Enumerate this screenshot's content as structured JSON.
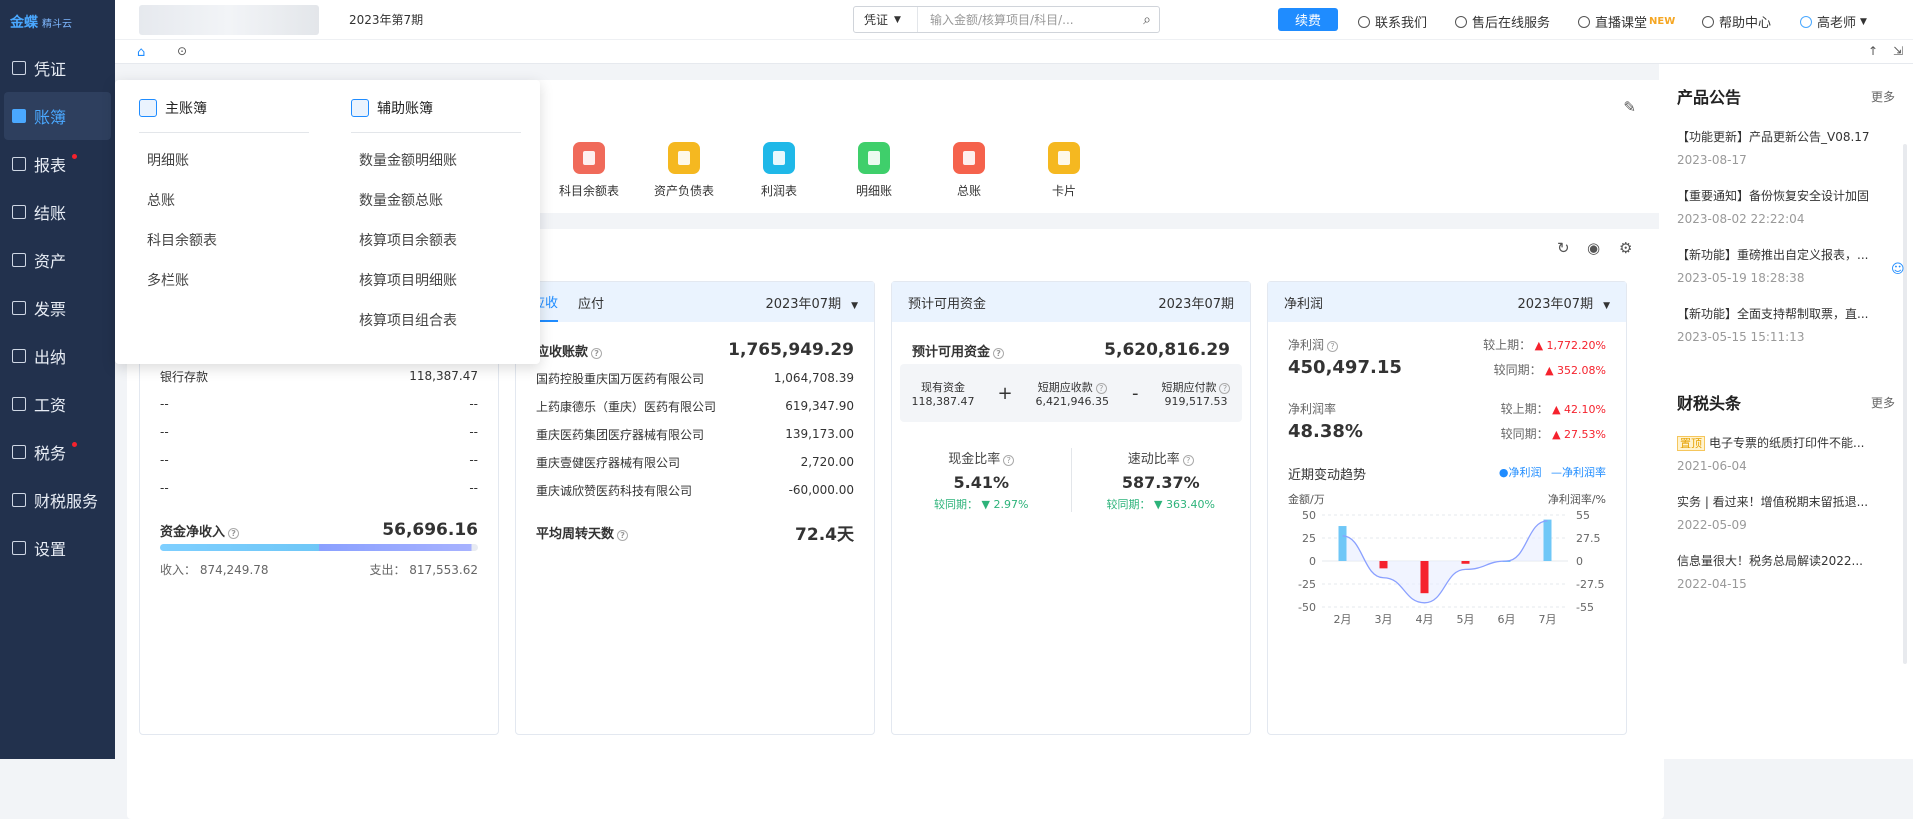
{
  "app": {
    "logo": "金蝶",
    "logo_sub": "精斗云",
    "period": "2023年第7期"
  },
  "sidebar": {
    "items": [
      {
        "label": "凭证"
      },
      {
        "label": "账簿"
      },
      {
        "label": "报表"
      },
      {
        "label": "结账"
      },
      {
        "label": "资产"
      },
      {
        "label": "发票"
      },
      {
        "label": "出纳"
      },
      {
        "label": "工资"
      },
      {
        "label": "税务"
      },
      {
        "label": "财税服务"
      },
      {
        "label": "设置"
      }
    ]
  },
  "search": {
    "select": "凭证",
    "placeholder": "输入金额/核算项目/科目/..."
  },
  "topbar": {
    "renew": "续费",
    "contact": "联系我们",
    "support": "售后在线服务",
    "live": "直播课堂",
    "live_badge": "NEW",
    "help": "帮助中心",
    "user": "高老师"
  },
  "dropdown": {
    "main_title": "主账簿",
    "main_items": [
      "明细账",
      "总账",
      "科目余额表",
      "多栏账"
    ],
    "aux_title": "辅助账簿",
    "aux_items": [
      "数量金额明细账",
      "数量金额总账",
      "核算项目余额表",
      "核算项目明细账",
      "核算项目组合表"
    ]
  },
  "quick": {
    "items": [
      {
        "label": "科目余额表",
        "color": "#f06a5a"
      },
      {
        "label": "资产负债表",
        "color": "#f5b820"
      },
      {
        "label": "利润表",
        "color": "#1fb8e8"
      },
      {
        "label": "明细账",
        "color": "#3fcf6b"
      },
      {
        "label": "总账",
        "color": "#f5624c"
      },
      {
        "label": "卡片",
        "color": "#f5b820"
      }
    ]
  },
  "cash": {
    "bank_label": "银行存款",
    "bank_value": "118,387.47",
    "dash_rows": [
      [
        "--",
        "--"
      ],
      [
        "--",
        "--"
      ],
      [
        "--",
        "--"
      ],
      [
        "--",
        "--"
      ]
    ],
    "net_label": "资金净收入",
    "net_value": "56,696.16",
    "income": "收入： 874,249.78",
    "expense": "支出： 817,553.62"
  },
  "receivable": {
    "tab1": "应收",
    "tab2": "应付",
    "period": "2023年07期",
    "title": "应收账款",
    "total": "1,765,949.29",
    "rows": [
      [
        "国药控股重庆国万医药有限公司",
        "1,064,708.39"
      ],
      [
        "上药康德乐（重庆）医药有限公司",
        "619,347.90"
      ],
      [
        "重庆医药集团医疗器械有限公司",
        "139,173.00"
      ],
      [
        "重庆壹健医疗器械有限公司",
        "2,720.00"
      ],
      [
        "重庆诚欣赞医药科技有限公司",
        "-60,000.00"
      ]
    ],
    "turnover_label": "平均周转天数",
    "turnover_value": "72.4天"
  },
  "funds": {
    "title": "预计可用资金",
    "period": "2023年07期",
    "label": "预计可用资金",
    "value": "5,620,816.29",
    "cash_label": "现有资金",
    "cash_value": "118,387.47",
    "plus": "+",
    "minus": "-",
    "recv_label": "短期应收款",
    "recv_value": "6,421,946.35",
    "pay_label": "短期应付款",
    "pay_value": "919,517.53",
    "cash_ratio_label": "现金比率",
    "cash_ratio": "5.41%",
    "cash_ratio_cmp": "较同期： ▼ 2.97%",
    "quick_ratio_label": "速动比率",
    "quick_ratio": "587.37%",
    "quick_ratio_cmp": "较同期： ▼ 363.40%"
  },
  "profit": {
    "title": "净利润",
    "period": "2023年07期",
    "label": "净利润",
    "value": "450,497.15",
    "prev_label": "较上期：",
    "prev_value": "▲ 1,772.20%",
    "yoy_label": "较同期：",
    "yoy_value": "▲ 352.08%",
    "rate_label": "净利润率",
    "rate_value": "48.38%",
    "rate_prev": "▲ 42.10%",
    "rate_yoy": "▲ 27.53%",
    "trend_label": "近期变动趋势",
    "legend1": "净利润",
    "legend2": "净利润率",
    "left_unit": "金额/万",
    "right_unit": "净利润率/%"
  },
  "chart_data": {
    "type": "bar",
    "categories": [
      "2月",
      "3月",
      "4月",
      "5月",
      "6月",
      "7月"
    ],
    "series": [
      {
        "name": "净利润",
        "values": [
          38,
          -8,
          -35,
          -3,
          0,
          45
        ]
      },
      {
        "name": "净利润率",
        "values": [
          30,
          -20,
          -50,
          -10,
          0,
          48
        ]
      }
    ],
    "ylabel": "金额/万",
    "y2label": "净利润率/%",
    "ylim": [
      -50,
      50
    ],
    "y2lim": [
      -55,
      55
    ],
    "yticks": [
      "50",
      "25",
      "0",
      "-25",
      "-50"
    ],
    "y2ticks": [
      "55",
      "27.5",
      "0",
      "-27.5",
      "-55"
    ],
    "colors": {
      "positive": "#6fc7f7",
      "negative": "#f5222d",
      "line": "#8aa0ff"
    }
  },
  "announcements": {
    "title": "产品公告",
    "more": "更多",
    "items": [
      {
        "text": "【功能更新】产品更新公告_V08.17",
        "date": "2023-08-17"
      },
      {
        "text": "【重要通知】备份恢复安全设计加固",
        "date": "2023-08-02 22:22:04"
      },
      {
        "text": "【新功能】重磅推出自定义报表，...",
        "date": "2023-05-19 18:28:38"
      },
      {
        "text": "【新功能】全面支持帮制取票，直...",
        "date": "2023-05-15 15:11:13"
      }
    ]
  },
  "tax_news": {
    "title": "财税头条",
    "more": "更多",
    "items": [
      {
        "tag": "置顶",
        "text": "电子专票的纸质打印件不能...",
        "date": "2021-06-04"
      },
      {
        "tag": "",
        "text": "实务 | 看过来！增值税期末留抵退...",
        "date": "2022-05-09"
      },
      {
        "tag": "",
        "text": "信息量很大！税务总局解读2022...",
        "date": "2022-04-15"
      }
    ]
  }
}
